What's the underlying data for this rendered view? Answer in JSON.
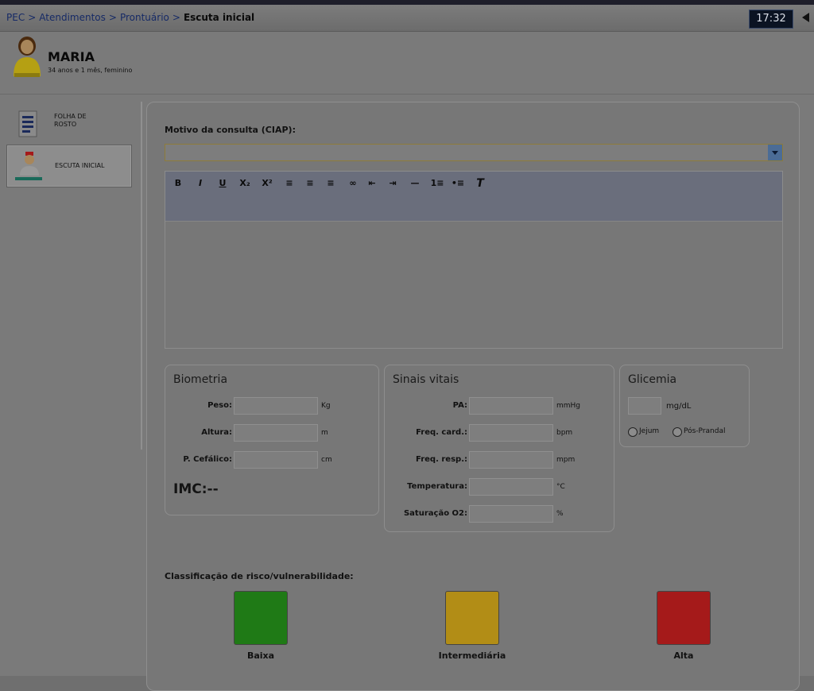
{
  "breadcrumb": {
    "items": [
      "PEC",
      "Atendimentos",
      "Prontuário"
    ],
    "current": "Escuta inicial",
    "separator": ">"
  },
  "clock": "17:32",
  "patient": {
    "name": "MARIA",
    "info": "34 anos e 1 mês, feminino"
  },
  "sidebar": {
    "items": [
      {
        "label_line1": "FOLHA DE",
        "label_line2": "ROSTO"
      },
      {
        "label_line1": "ESCUTA INICIAL",
        "label_line2": ""
      }
    ]
  },
  "motivo": {
    "label": "Motivo da consulta (CIAP):",
    "value": ""
  },
  "toolbar": {
    "buttons": [
      "B",
      "I",
      "U",
      "X₂",
      "X²",
      "≡",
      "≡",
      "≡",
      "∞",
      "⇤",
      "⇥",
      "—",
      "1≡",
      "•≡",
      "T"
    ]
  },
  "biometria": {
    "title": "Biometria",
    "fields": [
      {
        "label": "Peso:",
        "unit": "Kg",
        "value": ""
      },
      {
        "label": "Altura:",
        "unit": "m",
        "value": ""
      },
      {
        "label": "P. Cefálico:",
        "unit": "cm",
        "value": ""
      }
    ],
    "imc": "IMC:--"
  },
  "sinais": {
    "title": "Sinais vitais",
    "fields": [
      {
        "label": "PA:",
        "unit": "mmHg",
        "value": ""
      },
      {
        "label": "Freq. card.:",
        "unit": "bpm",
        "value": ""
      },
      {
        "label": "Freq. resp.:",
        "unit": "mpm",
        "value": ""
      },
      {
        "label": "Temperatura:",
        "unit": "°C",
        "value": ""
      },
      {
        "label": "Saturação O2:",
        "unit": "%",
        "value": ""
      }
    ]
  },
  "glicemia": {
    "title": "Glicemia",
    "unit": "mg/dL",
    "value": "",
    "options": [
      "Jejum",
      "Pós-Prandal"
    ]
  },
  "risco": {
    "label": "Classificação de risco/vulnerabilidade:",
    "levels": [
      {
        "name": "Baixa",
        "color": "#1f7a16"
      },
      {
        "name": "Intermediária",
        "color": "#b28d16"
      },
      {
        "name": "Alta",
        "color": "#a51a1a"
      }
    ]
  },
  "icons": {
    "avatar": "female-patient-avatar-icon",
    "folha": "document-icon",
    "escuta": "nurse-icon",
    "collapse": "collapse-arrow-icon"
  }
}
